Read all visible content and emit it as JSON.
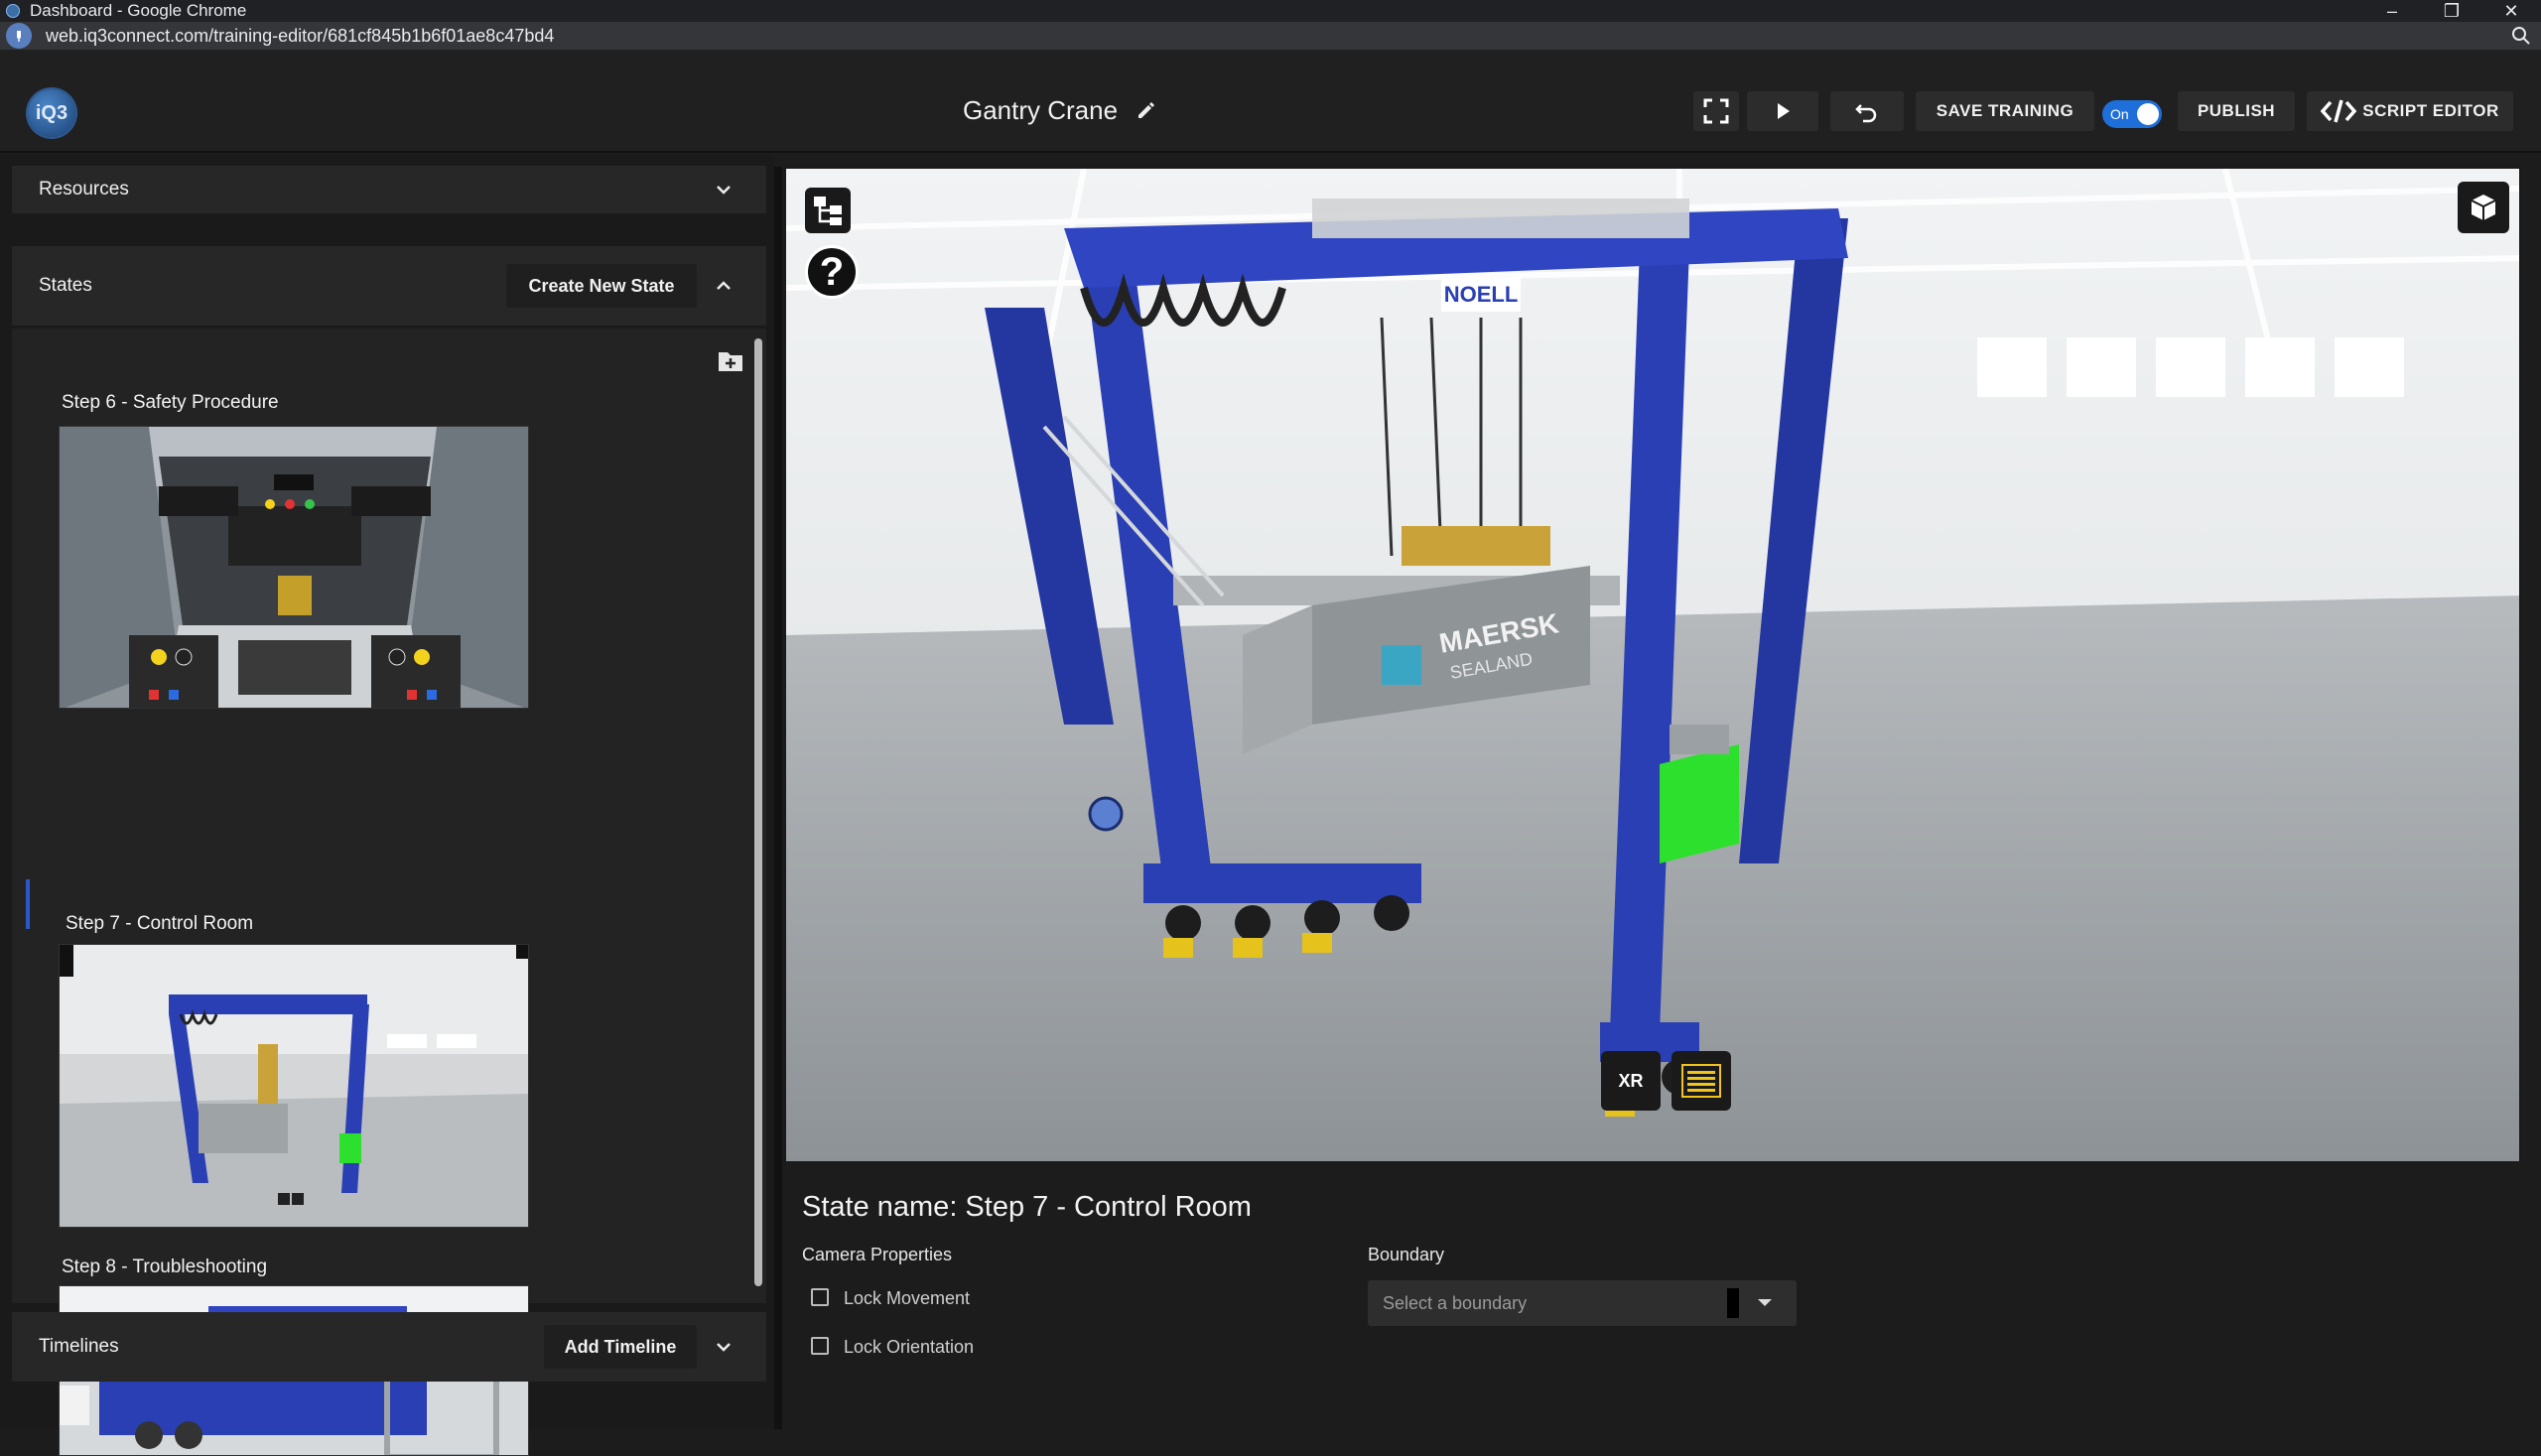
{
  "window": {
    "title": "Dashboard - Google Chrome",
    "url": "web.iq3connect.com/training-editor/681cf845b1b6f01ae8c47bd4"
  },
  "header": {
    "logo_text": "iQ3",
    "title": "Gantry Crane",
    "save_label": "SAVE TRAINING",
    "toggle_label": "On",
    "publish_label": "PUBLISH",
    "script_editor_label": "SCRIPT EDITOR"
  },
  "sidebar": {
    "resources_title": "Resources",
    "states_title": "States",
    "create_state_label": "Create New State",
    "timelines_title": "Timelines",
    "add_timeline_label": "Add Timeline",
    "states": [
      {
        "label": "Step 6 - Safety Procedure"
      },
      {
        "label": "Step 7 - Control Room",
        "active": true
      },
      {
        "label": "Step 8 - Troubleshooting"
      }
    ]
  },
  "viewport": {
    "xr_label": "XR",
    "help_label": "?",
    "brand_text": "NOELL",
    "container_text_1": "MAERSK",
    "container_text_2": "SEALAND"
  },
  "properties": {
    "state_name": "State name: Step 7 - Control Room",
    "camera_title": "Camera Properties",
    "lock_movement": "Lock Movement",
    "lock_orientation": "Lock Orientation",
    "boundary_title": "Boundary",
    "boundary_placeholder": "Select a boundary"
  },
  "colors": {
    "accent": "#1e6fd9",
    "crane_blue": "#2a3fb3",
    "panel_bg": "#232323",
    "highlight_green": "#2ee02e"
  }
}
